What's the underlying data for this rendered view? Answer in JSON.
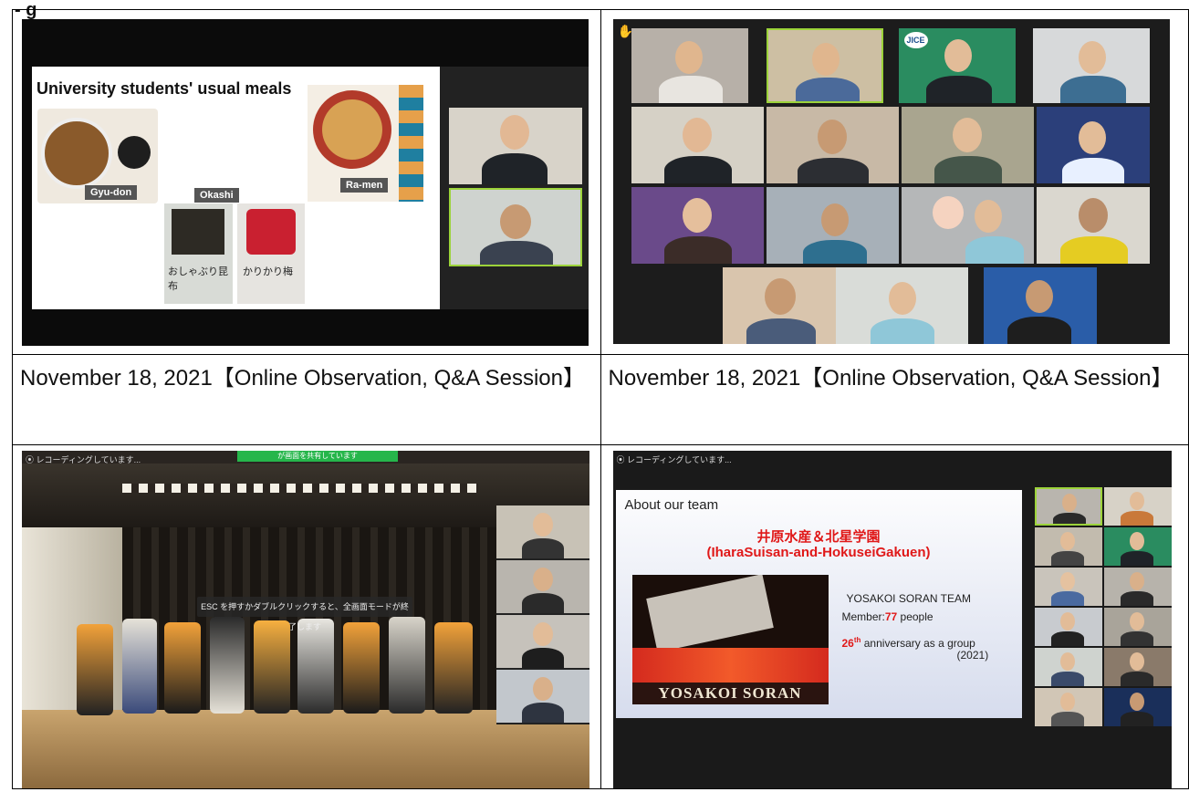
{
  "header_partial": "- g",
  "cells": {
    "top_left": {
      "slide_title": "University students' usual meals",
      "food_labels": {
        "gyudon": "Gyu-don",
        "okashi": "Okashi",
        "ramen": "Ra-men"
      },
      "snack_text_1": "おしゃぶり昆布",
      "snack_text_2": "かりかり梅"
    },
    "top_right": {
      "logo": "JICE"
    },
    "caption_left": "November 18, 2021【Online Observation, Q&A Session】",
    "caption_right": "November 18, 2021【Online Observation, Q&A Session】",
    "bottom_left": {
      "recording_text": "レコーディングしています...",
      "share_banner": "が画面を共有しています",
      "fullscreen_toast": "ESC を押すかダブルクリックすると、全画面モードが終了します"
    },
    "bottom_right": {
      "recording_text": "レコーディングしています...",
      "slide_heading": "About our team",
      "team_jp": "井原水産＆北星学園",
      "team_en": "(IharaSuisan-and-HokuseiGakuen)",
      "team_type": "YOSAKOI SORAN TEAM",
      "member_label": "Member:",
      "member_count": "77",
      "member_unit": " people",
      "anniv_num": "26",
      "anniv_sup": "th",
      "anniv_text": " anniversary as a group",
      "anniv_year": "(2021)",
      "photo_banner": "YOSAKOI SORAN"
    }
  }
}
